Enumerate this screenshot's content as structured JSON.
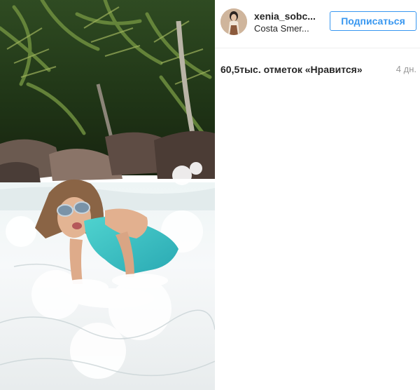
{
  "post": {
    "user": {
      "username": "xenia_sobc...",
      "location": "Costa Smer...",
      "follow_label": "Подписаться"
    },
    "likes_text": "60,5тыс. отметок «Нравится»",
    "time_ago": "4 дн."
  },
  "colors": {
    "accent": "#3897f0",
    "text": "#262626",
    "muted": "#999999",
    "divider": "#efefef"
  }
}
